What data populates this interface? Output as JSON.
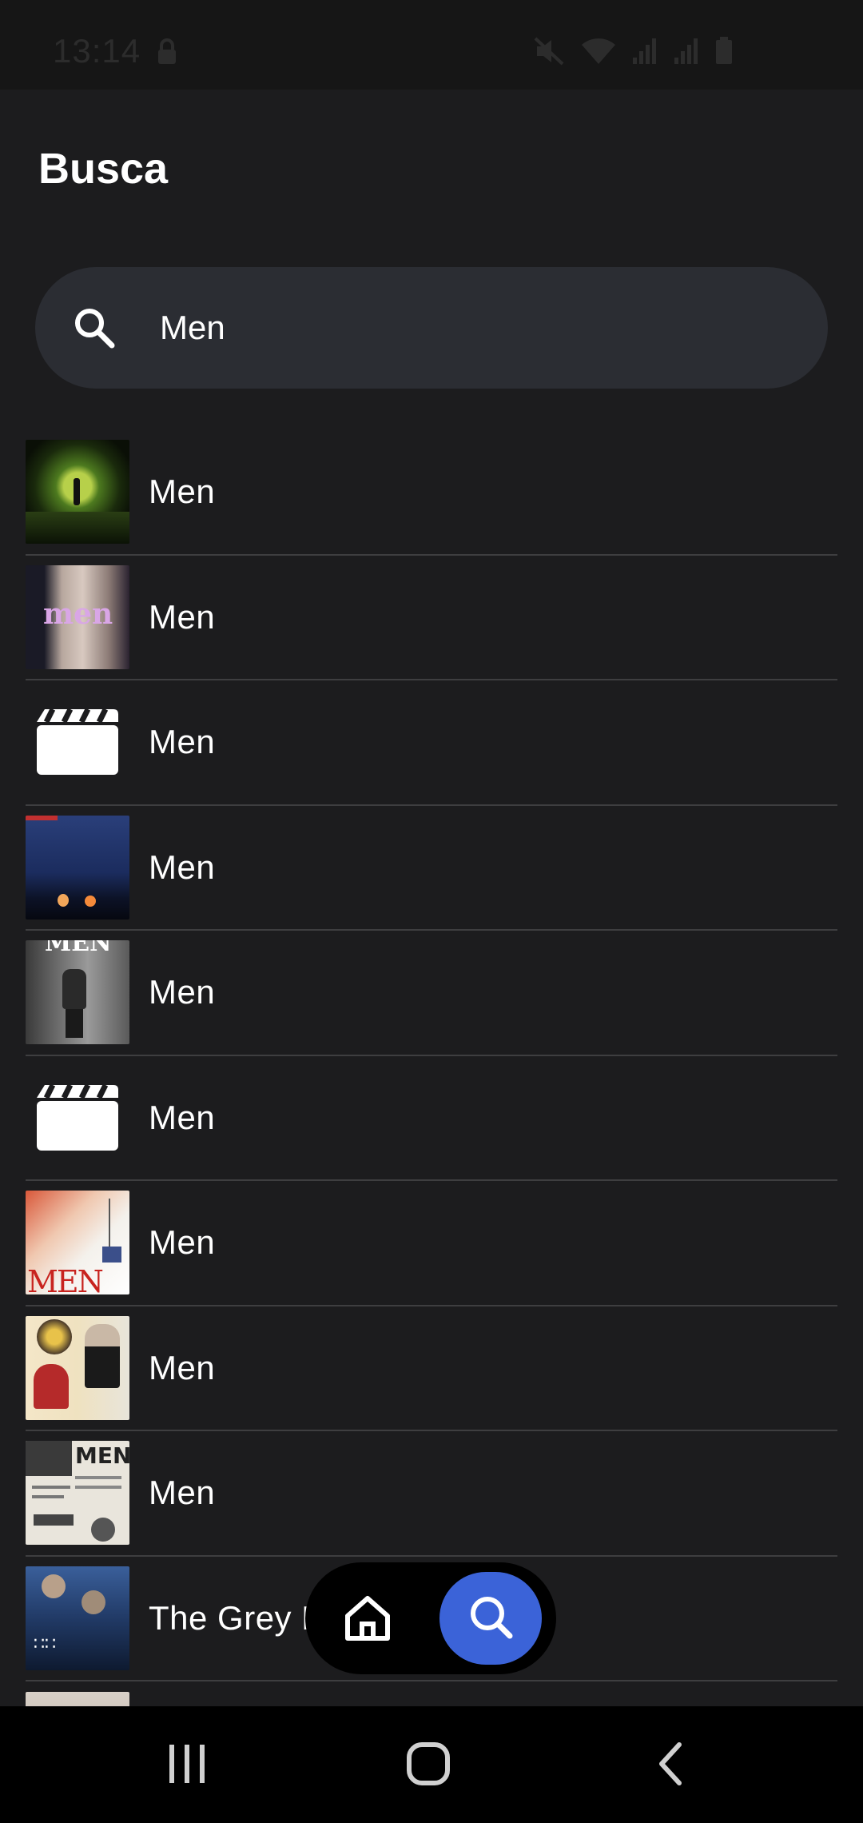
{
  "status_bar": {
    "time": "13:14",
    "icons": [
      "lock-icon",
      "mute-icon",
      "wifi-icon",
      "signal-icon",
      "signal-icon",
      "battery-icon"
    ]
  },
  "header": {
    "title": "Busca"
  },
  "search": {
    "value": "Men",
    "placeholder": ""
  },
  "results": [
    {
      "title": "Men",
      "poster": "tunnel-poster"
    },
    {
      "title": "Men",
      "poster": "men-mannequin-poster",
      "poster_text": "men"
    },
    {
      "title": "Men",
      "poster": "clapperboard-placeholder-icon"
    },
    {
      "title": "Men",
      "poster": "night-scene-poster"
    },
    {
      "title": "Men",
      "poster": "bw-street-poster",
      "poster_text": "MEN"
    },
    {
      "title": "Men",
      "poster": "red-title-poster",
      "poster_text": "MEN"
    },
    {
      "title": "Men",
      "poster": "clapperboard-placeholder-icon"
    },
    {
      "title": "Men",
      "poster": "vintage-couple-poster"
    },
    {
      "title": "Men",
      "poster": "newspaper-ad-poster",
      "poster_text": "MEN"
    },
    {
      "title": "The Grey M",
      "poster": "action-poster"
    }
  ],
  "bottom_nav": {
    "items": [
      "home-icon",
      "search-icon"
    ],
    "active": "search"
  },
  "system_nav": {
    "items": [
      "recents-icon",
      "home-button-icon",
      "back-icon"
    ]
  },
  "colors": {
    "background": "#1c1c1e",
    "search_bg": "#2b2d33",
    "accent": "#3b63d8",
    "divider": "#3e3e40"
  }
}
